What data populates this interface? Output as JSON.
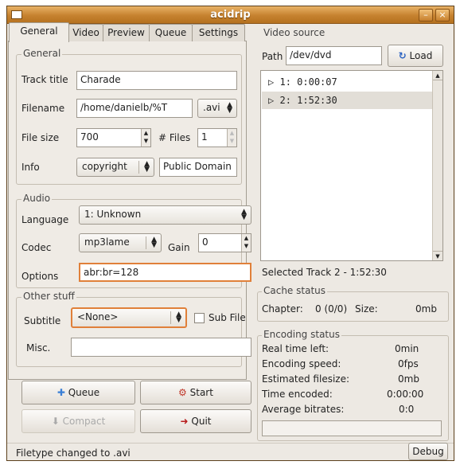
{
  "window": {
    "title": "acidrip"
  },
  "tabs": [
    {
      "label": "General"
    },
    {
      "label": "Video"
    },
    {
      "label": "Preview"
    },
    {
      "label": "Queue"
    },
    {
      "label": "Settings"
    }
  ],
  "general": {
    "section_label": "General",
    "track_title": {
      "label": "Track title",
      "value": "Charade"
    },
    "filename": {
      "label": "Filename",
      "value": "/home/danielb/%T",
      "ext": ".avi"
    },
    "file_size": {
      "label": "File size",
      "value": "700",
      "files_label": "# Files",
      "files_value": "1"
    },
    "info": {
      "label": "Info",
      "key": "copyright",
      "value": "Public Domain"
    }
  },
  "audio": {
    "section_label": "Audio",
    "language": {
      "label": "Language",
      "value": "1: Unknown"
    },
    "codec": {
      "label": "Codec",
      "value": "mp3lame",
      "gain_label": "Gain",
      "gain_value": "0"
    },
    "options": {
      "label": "Options",
      "value": "abr:br=128"
    }
  },
  "other": {
    "section_label": "Other stuff",
    "subtitle": {
      "label": "Subtitle",
      "value": "<None>",
      "subfile_label": "Sub File"
    },
    "misc": {
      "label": "Misc.",
      "value": ""
    }
  },
  "buttons": {
    "queue": "Queue",
    "start": "Start",
    "compact": "Compact",
    "quit": "Quit",
    "load": "Load",
    "debug": "Debug"
  },
  "video_source": {
    "section_label": "Video source",
    "path_label": "Path",
    "path_value": "/dev/dvd",
    "tracks": [
      {
        "label": "1: 0:00:07",
        "selected": false
      },
      {
        "label": "2: 1:52:30",
        "selected": true
      }
    ],
    "selected_text": "Selected Track 2 - 1:52:30"
  },
  "cache_status": {
    "section_label": "Cache status",
    "chapter_label": "Chapter:",
    "chapter_value": "0 (0/0)",
    "size_label": "Size:",
    "size_value": "0mb"
  },
  "encoding_status": {
    "section_label": "Encoding status",
    "rows": [
      {
        "label": "Real time left:",
        "value": "0min"
      },
      {
        "label": "Encoding speed:",
        "value": "0fps"
      },
      {
        "label": "Estimated filesize:",
        "value": "0mb"
      },
      {
        "label": "Time encoded:",
        "value": "0:00:00"
      },
      {
        "label": "Average bitrates:",
        "value": "0:0"
      }
    ],
    "progress": 0
  },
  "statusbar": {
    "text": "Filetype changed to .avi"
  },
  "colors": {
    "title_bar": "#c6822f",
    "selected_row": "#e2ded7",
    "focus_border": "#e0803a"
  }
}
